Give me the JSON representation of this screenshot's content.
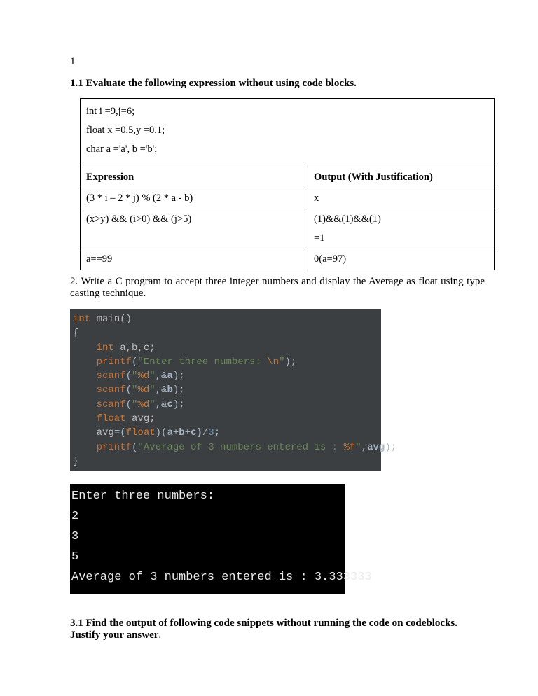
{
  "page_number": "1",
  "q11_heading": "1.1 Evaluate the following expression without using code blocks.",
  "decl": {
    "l1": "int i =9,j=6;",
    "l2": "float x =0.5,y =0.1;",
    "l3": "char a ='a', b ='b';"
  },
  "table_headers": {
    "expr": "Expression",
    "out": "Output (With Justification)"
  },
  "rows": [
    {
      "expr": "(3 *  i – 2 * j) %  (2 * a - b)",
      "out": "x"
    },
    {
      "expr": "(x>y) && (i>0) && (j>5)",
      "out": "(1)&&(1)&&(1)",
      "out2": "=1"
    },
    {
      "expr": "a==99",
      "out": "0(a=97)"
    }
  ],
  "q2_para": "2. Write a C program to accept three integer numbers and display the Average as float using type casting technique.",
  "code": {
    "l1a": "int",
    "l1b": " main()",
    "l2": "{",
    "l3a": "    int",
    "l3b": " a,b,c;",
    "l4a": "    printf",
    "l4b": "(",
    "l4c": "\"Enter three numbers: ",
    "l4d": "\\n",
    "l4e": "\"",
    "l4f": ");",
    "l5a": "    scanf",
    "l5b": "(",
    "l5c": "\"",
    "l5d": "%d",
    "l5e": "\"",
    "l5f": ",&",
    "l5g": "a",
    "l5h": ");",
    "l6a": "    scanf",
    "l6b": "(",
    "l6c": "\"",
    "l6d": "%d",
    "l6e": "\"",
    "l6f": ",&",
    "l6g": "b",
    "l6h": ");",
    "l7a": "    scanf",
    "l7b": "(",
    "l7c": "\"",
    "l7d": "%d",
    "l7e": "\"",
    "l7f": ",&",
    "l7g": "c",
    "l7h": ");",
    "l8a": "    float",
    "l8b": " avg;",
    "l9a": "    avg",
    "l9b": "=",
    "l9c": "(",
    "l9d": "float",
    "l9e": ")(a",
    "l9f": "+",
    "l9g": "b",
    "l9h": "+",
    "l9i": "c)",
    "l9j": "/",
    "l9k": "3",
    "l9l": ";",
    "l10a": "    printf",
    "l10b": "(",
    "l10c": "\"Average of 3 numbers entered is : ",
    "l10d": "%f",
    "l10e": "\"",
    "l10f": ",",
    "l10g": "avg",
    "l10h": ");",
    "l11": "}"
  },
  "terminal": "Enter three numbers:\n2\n3\n5\nAverage of 3 numbers entered is : 3.333333",
  "q31_heading_a": "3.1 Find the output of following code snippets without running the code on codeblocks. Justify your answer",
  "q31_dot": "."
}
